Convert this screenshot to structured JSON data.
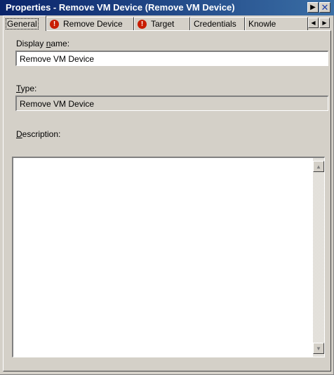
{
  "window": {
    "title": "Properties - Remove VM Device (Remove VM Device)",
    "menu_glyph": "▶",
    "close_glyph": "✕"
  },
  "tabs": [
    {
      "label": "General",
      "active": true,
      "warning": false
    },
    {
      "label": "Remove Device",
      "active": false,
      "warning": true
    },
    {
      "label": "Target",
      "active": false,
      "warning": true
    },
    {
      "label": "Credentials",
      "active": false,
      "warning": false
    },
    {
      "label": "Knowle",
      "active": false,
      "warning": false
    }
  ],
  "tab_scroll": {
    "left": "◀",
    "right": "▶"
  },
  "warning_glyph": "!",
  "form": {
    "display_name": {
      "label_pre": "Display ",
      "label_key": "n",
      "label_post": "ame:",
      "value": "Remove VM Device"
    },
    "type": {
      "label_key": "T",
      "label_post": "ype:",
      "value": "Remove VM Device"
    },
    "description": {
      "label_key": "D",
      "label_post": "escription:",
      "value": ""
    }
  },
  "scroll": {
    "up": "▲",
    "down": "▼"
  }
}
